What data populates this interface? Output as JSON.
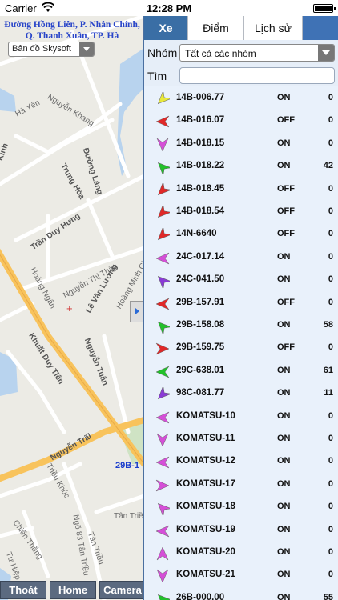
{
  "status_bar": {
    "carrier": "Carrier",
    "time": "12:28 PM"
  },
  "map": {
    "address": "Đường Hồng Liên, P. Nhân Chính, Q. Thanh Xuân, TP. Hà",
    "map_type": "Bản đồ Skysoft",
    "vehicle_label": "29B-1",
    "streets": {
      "nguyen_khang": "Nguyễn Khang",
      "ha_yen": "Hà Yên",
      "duong_lang": "Đường Láng",
      "trung_hoa": "Trung Hòa",
      "kinh": "Kinh",
      "tran_duy_hung": "Trần Duy Hưng",
      "hoang_ngan": "Hoàng Ngân",
      "nguyen_thi_thap": "Nguyễn Thị Thập",
      "le_van_luong": "Lê Văn Lương",
      "hoang_minh_giam": "Hoàng Minh Giám",
      "khuat_duy_tien": "Khuất Duy Tiến",
      "nguyen_tuan": "Nguyễn Tuân",
      "nguyen_trai": "Nguyễn Trãi",
      "trieu_khuc": "Triều Khúc",
      "chien_thang": "Chiến Thắng",
      "tan_trieu": "Tân Triều",
      "tan_trieu_2": "Tân Triều",
      "tu_hiep": "Tứ Hiệp",
      "ngo_83": "Ngõ 83 Tân Triều"
    },
    "buttons": {
      "exit": "Thoát",
      "home": "Home",
      "camera": "Camera"
    }
  },
  "panel": {
    "tabs": [
      "Xe",
      "Điểm",
      "Lịch sử"
    ],
    "filter": {
      "group_label": "Nhóm",
      "group_value": "Tất cả các nhóm",
      "search_label": "Tìm",
      "search_value": ""
    },
    "vehicles": [
      {
        "plate": "14B-006.77",
        "status": "ON",
        "speed": "0",
        "color": "#e8e83a",
        "direction": "down-left"
      },
      {
        "plate": "14B-016.07",
        "status": "OFF",
        "speed": "0",
        "color": "#e02828",
        "direction": "left"
      },
      {
        "plate": "14B-018.15",
        "status": "ON",
        "speed": "0",
        "color": "#d54fd8",
        "direction": "down"
      },
      {
        "plate": "14B-018.22",
        "status": "ON",
        "speed": "42",
        "color": "#22c12a",
        "direction": "up-left"
      },
      {
        "plate": "14B-018.45",
        "status": "OFF",
        "speed": "0",
        "color": "#e02828",
        "direction": "down-left"
      },
      {
        "plate": "14B-018.54",
        "status": "OFF",
        "speed": "0",
        "color": "#e02828",
        "direction": "down-left"
      },
      {
        "plate": "14N-6640",
        "status": "OFF",
        "speed": "0",
        "color": "#e02828",
        "direction": "down-left"
      },
      {
        "plate": "24C-017.14",
        "status": "ON",
        "speed": "0",
        "color": "#d54fd8",
        "direction": "left"
      },
      {
        "plate": "24C-041.50",
        "status": "ON",
        "speed": "0",
        "color": "#8a3bd6",
        "direction": "up-left"
      },
      {
        "plate": "29B-157.91",
        "status": "OFF",
        "speed": "0",
        "color": "#e02828",
        "direction": "left"
      },
      {
        "plate": "29B-158.08",
        "status": "ON",
        "speed": "58",
        "color": "#22c12a",
        "direction": "up-left"
      },
      {
        "plate": "29B-159.75",
        "status": "OFF",
        "speed": "0",
        "color": "#e02828",
        "direction": "right"
      },
      {
        "plate": "29C-638.01",
        "status": "ON",
        "speed": "61",
        "color": "#22c12a",
        "direction": "left"
      },
      {
        "plate": "98C-081.77",
        "status": "ON",
        "speed": "11",
        "color": "#8a3bd6",
        "direction": "down-left"
      },
      {
        "plate": "KOMATSU-10",
        "status": "ON",
        "speed": "0",
        "color": "#d54fd8",
        "direction": "left"
      },
      {
        "plate": "KOMATSU-11",
        "status": "ON",
        "speed": "0",
        "color": "#d54fd8",
        "direction": "down"
      },
      {
        "plate": "KOMATSU-12",
        "status": "ON",
        "speed": "0",
        "color": "#d54fd8",
        "direction": "left"
      },
      {
        "plate": "KOMATSU-17",
        "status": "ON",
        "speed": "0",
        "color": "#d54fd8",
        "direction": "right"
      },
      {
        "plate": "KOMATSU-18",
        "status": "ON",
        "speed": "0",
        "color": "#d54fd8",
        "direction": "up-left"
      },
      {
        "plate": "KOMATSU-19",
        "status": "ON",
        "speed": "0",
        "color": "#d54fd8",
        "direction": "left"
      },
      {
        "plate": "KOMATSU-20",
        "status": "ON",
        "speed": "0",
        "color": "#d54fd8",
        "direction": "up"
      },
      {
        "plate": "KOMATSU-21",
        "status": "ON",
        "speed": "0",
        "color": "#d54fd8",
        "direction": "down"
      },
      {
        "plate": "26B-000.00",
        "status": "ON",
        "speed": "55",
        "color": "#22c12a",
        "direction": "up-left"
      }
    ]
  }
}
